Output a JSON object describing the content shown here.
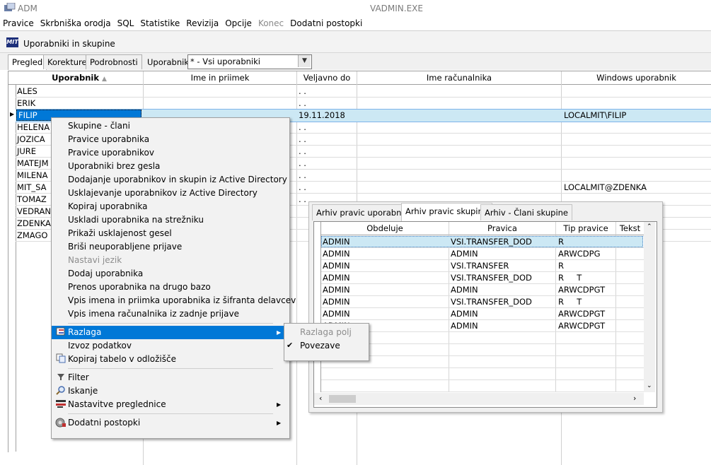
{
  "app": {
    "title": "ADM",
    "exe": "VADMIN.EXE"
  },
  "menubar": [
    "Pravice",
    "Skrbniška orodja",
    "SQL",
    "Statistike",
    "Revizija",
    "Opcije",
    "Konec",
    "Dodatni postopki"
  ],
  "window": {
    "logo": "MIT",
    "title": "Uporabniki in skupine"
  },
  "tabs": [
    "Pregled",
    "Korekture",
    "Podrobnosti"
  ],
  "filter": {
    "label": "Uporabniki:",
    "value": "* - Vsi uporabniki"
  },
  "grid": {
    "columns": [
      "Uporabnik",
      "Ime in priimek",
      "Veljavno do",
      "Ime računalnika",
      "Windows uporabnik"
    ],
    "rows": [
      {
        "user": "ALES",
        "valid": ". .",
        "win": ""
      },
      {
        "user": "ERIK",
        "valid": ". .",
        "win": ""
      },
      {
        "user": "FILIP",
        "valid": "19.11.2018",
        "win": "LOCALMIT\\FILIP"
      },
      {
        "user": "HELENA",
        "valid": ". .",
        "win": ""
      },
      {
        "user": "JOZICA",
        "valid": ". .",
        "win": ""
      },
      {
        "user": "JURE",
        "valid": ". .",
        "win": ""
      },
      {
        "user": "MATEJM",
        "valid": ". .",
        "win": ""
      },
      {
        "user": "MILENA",
        "valid": ". .",
        "win": ""
      },
      {
        "user": "MIT_SA",
        "valid": ". .",
        "win": "LOCALMIT@ZDENKA"
      },
      {
        "user": "TOMAZ",
        "valid": ". .",
        "win": ""
      },
      {
        "user": "VEDRANA",
        "valid": "",
        "win": ""
      },
      {
        "user": "ZDENKA",
        "valid": "",
        "win": ""
      },
      {
        "user": "ZMAGO",
        "valid": "",
        "win": ""
      }
    ]
  },
  "context_menu": {
    "items": [
      "Skupine - člani",
      "Pravice uporabnika",
      "Pravice uporabnikov",
      "Uporabniki brez gesla",
      "Dodajanje uporabnikov in skupin iz Active Directory",
      "Usklajevanje uporabnikov iz Active Directory",
      "Kopiraj uporabnika",
      "Uskladi uporabnika na strežniku",
      "Prikaži usklajenost gesel",
      "Briši neuporabljene prijave",
      "Nastavi jezik",
      "Dodaj uporabnika",
      "Prenos uporabnika na drugo bazo",
      "Vpis imena in priimka uporabnika iz šifranta delavcev",
      "Vpis imena računalnika iz zadnje prijave"
    ],
    "razlaga": "Razlaga",
    "izvoz": "Izvoz podatkov",
    "kopiraj_tabelo": "Kopiraj tabelo v odložišče",
    "filter": "Filter",
    "iskanje": "Iskanje",
    "nastavitve": "Nastavitve preglednice",
    "dodatni": "Dodatni postopki"
  },
  "submenu": {
    "items": [
      "Razlaga polj",
      "Povezave"
    ],
    "check": "✔"
  },
  "panel": {
    "tabs": [
      "Arhiv pravic uporabnika",
      "Arhiv pravic skupine",
      "Arhiv - Člani skupine"
    ],
    "columns": [
      "Obdeluje",
      "Pravica",
      "Tip pravice",
      "Tekst"
    ],
    "rows": [
      [
        "ADMIN",
        "VSI.TRANSFER_DOD",
        "R"
      ],
      [
        "ADMIN",
        "ADMIN",
        "ARWCDPG"
      ],
      [
        "ADMIN",
        "VSI.TRANSFER",
        "R"
      ],
      [
        "ADMIN",
        "VSI.TRANSFER_DOD",
        "R     T"
      ],
      [
        "ADMIN",
        "ADMIN",
        "ARWCDPGT"
      ],
      [
        "ADMIN",
        "VSI.TRANSFER_DOD",
        "R     T"
      ],
      [
        "ADMIN",
        "ADMIN",
        "ARWCDPGT"
      ],
      [
        "ADMIN",
        "ADMIN",
        "ARWCDPGT"
      ]
    ]
  },
  "colors": {
    "selection": "#0078d7",
    "row_highlight": "#cce8f4"
  }
}
